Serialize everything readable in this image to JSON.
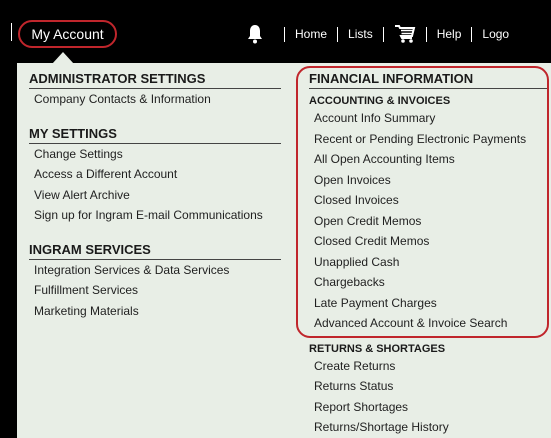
{
  "header": {
    "account_label": "My Account",
    "nav": {
      "bell_icon": "bell-icon",
      "home": "Home",
      "lists": "Lists",
      "cart_icon": "cart-icon",
      "help": "Help",
      "logout": "Logo"
    }
  },
  "colors": {
    "top_bar": "#000000",
    "panel_bg": "#e8eee6",
    "highlight": "#c0262c"
  },
  "menu": {
    "admin": {
      "title": "ADMINISTRATOR SETTINGS",
      "items": [
        "Company Contacts & Information"
      ]
    },
    "my_settings": {
      "title": "MY SETTINGS",
      "items": [
        "Change Settings",
        "Access a Different Account",
        "View Alert Archive",
        "Sign up for Ingram E-mail Communications"
      ]
    },
    "ingram_services": {
      "title": "INGRAM SERVICES",
      "items": [
        "Integration Services & Data Services",
        "Fulfillment Services",
        "Marketing Materials"
      ]
    },
    "financial": {
      "title": "FINANCIAL INFORMATION",
      "accounting_title": "ACCOUNTING & INVOICES",
      "accounting_items": [
        "Account Info Summary",
        "Recent or Pending Electronic Payments",
        "All Open Accounting Items",
        "Open Invoices",
        "Closed Invoices",
        "Open Credit Memos",
        "Closed Credit Memos",
        "Unapplied Cash",
        "Chargebacks",
        "Late Payment Charges",
        "Advanced Account & Invoice Search"
      ],
      "returns_title": "RETURNS & SHORTAGES",
      "returns_items": [
        "Create Returns",
        "Returns Status",
        "Report Shortages",
        "Returns/Shortage History"
      ]
    }
  }
}
